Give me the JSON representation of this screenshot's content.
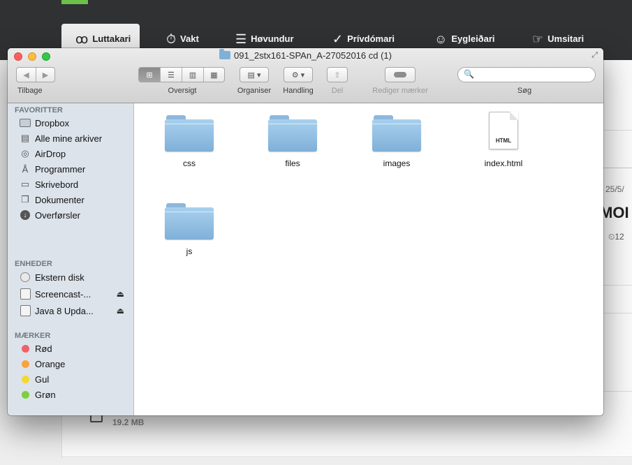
{
  "background_app": {
    "tabs": [
      {
        "label": "Luttakari",
        "icon": "ꝏ"
      },
      {
        "label": "Vakt",
        "icon": "⏱"
      },
      {
        "label": "Høvundur",
        "icon": "☰"
      },
      {
        "label": "Prívdómari",
        "icon": "✓"
      },
      {
        "label": "Eygleiðari",
        "icon": "☺"
      },
      {
        "label": "Umsitari",
        "icon": "☞"
      }
    ],
    "partial_date": "25/5/",
    "partial_heading": "MOI",
    "partial_time_prefix": "12",
    "file_size": "19.2 MB",
    "clock_icon": "⏲"
  },
  "finder": {
    "title": "091_2stx161-SPAn_A-27052016 cd (1)",
    "fullscreen_icon": "⤢",
    "toolbar": {
      "back_label": "Tilbage",
      "back_icon": "◀",
      "forward_icon": "▶",
      "view_label": "Oversigt",
      "view_icons": [
        "⊞",
        "☰",
        "▥",
        "▦"
      ],
      "arrange_label": "Organiser",
      "arrange_icon": "▤ ▾",
      "action_label": "Handling",
      "action_icon": "⚙ ▾",
      "share_label": "Del",
      "share_icon": "⇪",
      "tags_label": "Rediger mærker",
      "search_label": "Søg",
      "search_icon": "🔍",
      "search_value": ""
    },
    "sidebar": {
      "favorites_header": "FAVORITTER",
      "favorites": [
        {
          "label": "Dropbox",
          "icon": "folder-icon"
        },
        {
          "label": "Alle mine arkiver",
          "icon": "all-files-icon"
        },
        {
          "label": "AirDrop",
          "icon": "airdrop-icon"
        },
        {
          "label": "Programmer",
          "icon": "applications-icon"
        },
        {
          "label": "Skrivebord",
          "icon": "desktop-icon"
        },
        {
          "label": "Dokumenter",
          "icon": "documents-icon"
        },
        {
          "label": "Overførsler",
          "icon": "downloads-icon"
        }
      ],
      "devices_header": "ENHEDER",
      "devices": [
        {
          "label": "Ekstern disk",
          "icon": "disc-icon"
        },
        {
          "label": "Screencast-...",
          "icon": "disk-image-icon",
          "eject": "⏏"
        },
        {
          "label": "Java 8 Upda...",
          "icon": "disk-image-icon",
          "eject": "⏏"
        }
      ],
      "tags_header": "MÆRKER",
      "tags": [
        {
          "label": "Rød",
          "color": "#f0616a"
        },
        {
          "label": "Orange",
          "color": "#f9a33c"
        },
        {
          "label": "Gul",
          "color": "#f5d731"
        },
        {
          "label": "Grøn",
          "color": "#7ccf3f"
        }
      ]
    },
    "files": [
      {
        "name": "css",
        "kind": "folder"
      },
      {
        "name": "files",
        "kind": "folder"
      },
      {
        "name": "images",
        "kind": "folder"
      },
      {
        "name": "index.html",
        "kind": "document",
        "badge": "HTML"
      },
      {
        "name": "js",
        "kind": "folder"
      }
    ]
  }
}
